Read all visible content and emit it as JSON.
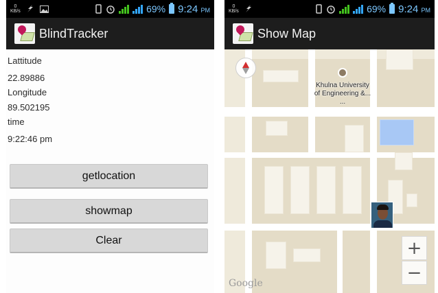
{
  "status_bar": {
    "net_speed": "0",
    "net_unit": "KB/s",
    "battery_pct": "69%",
    "time": "9:24",
    "ampm": "PM"
  },
  "left_screen": {
    "app_title": "BlindTracker",
    "latitude_label": "Lattitude",
    "latitude_value": "22.89886",
    "longitude_label": "Longitude",
    "longitude_value": "89.502195",
    "time_label": "time",
    "time_value": "9:22:46 pm",
    "buttons": {
      "getlocation": "getlocation",
      "showmap": "showmap",
      "clear": "Clear"
    }
  },
  "right_screen": {
    "app_title": "Show Map",
    "poi_line1": "Khulna University",
    "poi_line2": "of Engineering &...",
    "poi_dots": "...",
    "zoom_in": "+",
    "zoom_out": "−",
    "attribution": "Google"
  },
  "colors": {
    "status_text": "#7cc7ff",
    "signal_green": "#44c21e",
    "map_land": "#efeadb",
    "map_water": "#a8c8f5",
    "button_bg": "#d8d8d8"
  },
  "icons": {
    "app": "map-pin-app-icon",
    "compass": "compass-icon",
    "poi": "university-icon"
  }
}
